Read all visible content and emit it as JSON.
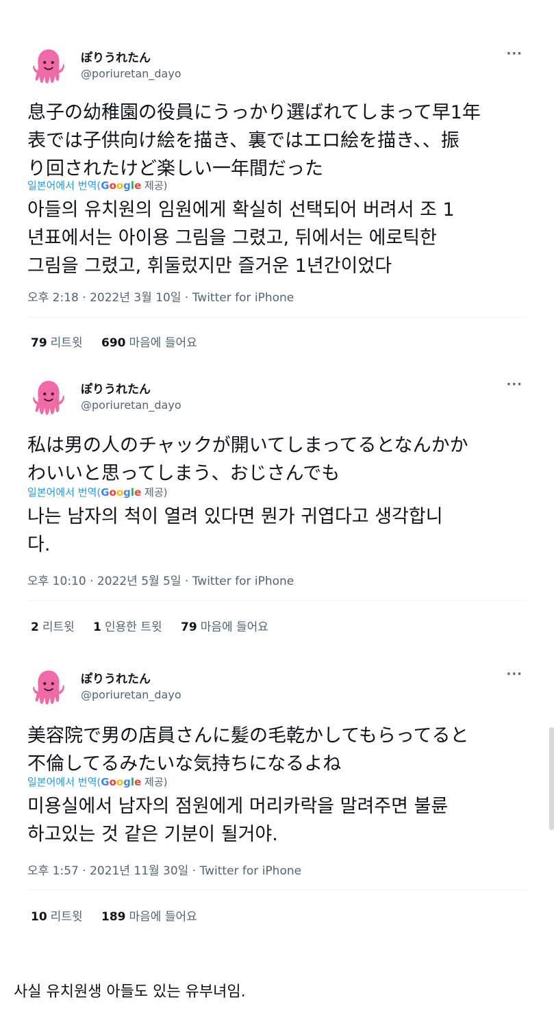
{
  "tweets": [
    {
      "name": "ぽりうれたん",
      "handle": "@poriuretan_dayo",
      "text": "息子の幼稚園の役員にうっかり選ばれてしまって早1年\n表では子供向け絵を描き、裏ではエロ絵を描き、、振\nり回されたけど楽しい一年間だった",
      "translate_label": "일본어에서 번역(",
      "google": "Google",
      "translate_provide": " 제공)",
      "translation": "아들의 유치원의 임원에게 확실히 선택되어 버려서 조 1\n년표에서는 아이용 그림을 그렸고, 뒤에서는 에로틱한\n그림을 그렸고, 휘둘렀지만 즐거운 1년간이었다",
      "meta": "오후 2:18 · 2022년 3월 10일 · Twitter for iPhone",
      "stats": [
        {
          "num": "79",
          "label": "리트윗"
        },
        {
          "num": "690",
          "label": "마음에 들어요"
        }
      ]
    },
    {
      "name": "ぽりうれたん",
      "handle": "@poriuretan_dayo",
      "text": "私は男の人のチャックが開いてしまってるとなんかか\nわいいと思ってしまう、おじさんでも",
      "translate_label": "일본어에서 번역(",
      "google": "Google",
      "translate_provide": " 제공)",
      "translation": "나는 남자의 척이 열려 있다면 뭔가 귀엽다고 생각합니\n다.",
      "meta": "오후 10:10 · 2022년 5월 5일 · Twitter for iPhone",
      "stats": [
        {
          "num": "2",
          "label": "리트윗"
        },
        {
          "num": "1",
          "label": "인용한 트윗"
        },
        {
          "num": "79",
          "label": "마음에 들어요"
        }
      ]
    },
    {
      "name": "ぽりうれたん",
      "handle": "@poriuretan_dayo",
      "text": "美容院で男の店員さんに髪の毛乾かしてもらってると\n不倫してるみたいな気持ちになるよね",
      "translate_label": "일본어에서 번역(",
      "google": "Google",
      "translate_provide": " 제공)",
      "translation": "미용실에서 남자의 점원에게 머리카락을 말려주면 불륜\n하고있는 것 같은 기분이 될거야.",
      "meta": "오후 1:57 · 2021년 11월 30일 · Twitter for iPhone",
      "stats": [
        {
          "num": "10",
          "label": "리트윗"
        },
        {
          "num": "189",
          "label": "마음에 들어요"
        }
      ]
    }
  ],
  "more_glyph": "···",
  "caption": "사실 유치원생 아들도 있는 유부녀임.",
  "colors": {
    "avatar": "#f06aa8",
    "link": "#1d9bf0",
    "secondary": "#536471"
  }
}
